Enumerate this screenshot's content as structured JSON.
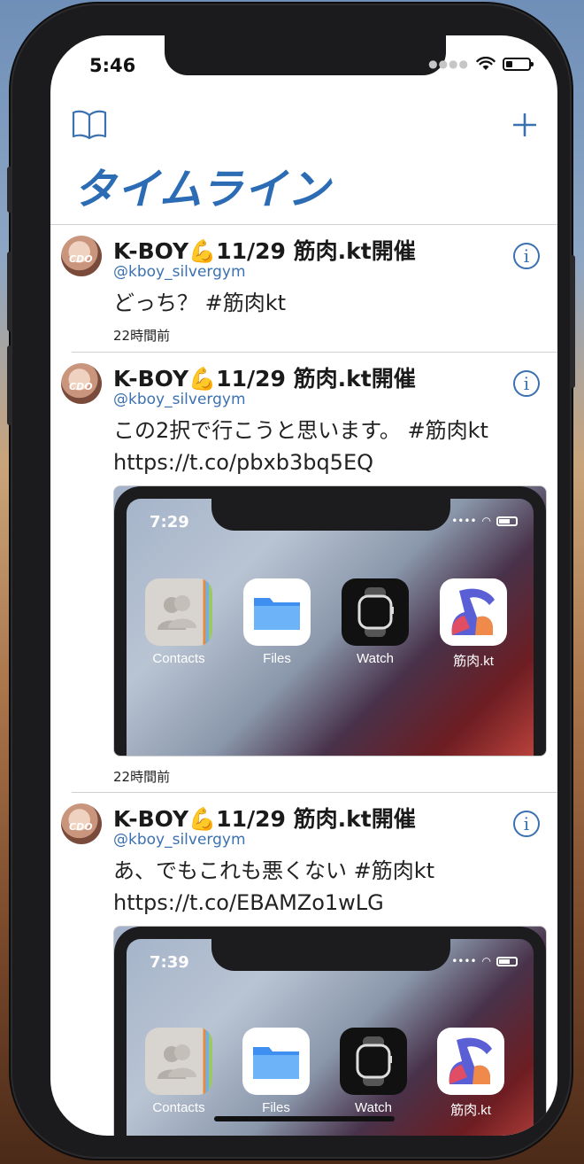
{
  "status_bar": {
    "time": "5:46"
  },
  "header": {
    "title": "タイムライン"
  },
  "posts": [
    {
      "name": "K-BOY💪11/29 筋肉.kt開催",
      "handle": "@kboy_silvergym",
      "text_lines": [
        "どっち？ #筋肉kt"
      ],
      "time": "22時間前"
    },
    {
      "name": "K-BOY💪11/29 筋肉.kt開催",
      "handle": "@kboy_silvergym",
      "text_lines": [
        "この2択で行こうと思います。 #筋肉kt",
        "https://t.co/pbxb3bq5EQ"
      ],
      "time": "22時間前",
      "media": {
        "time": "7:29",
        "apps": [
          {
            "label": "Contacts",
            "icon": "contacts-icon"
          },
          {
            "label": "Files",
            "icon": "files-icon"
          },
          {
            "label": "Watch",
            "icon": "watch-icon"
          },
          {
            "label": "筋肉.kt",
            "icon": "muscle-icon"
          }
        ]
      }
    },
    {
      "name": "K-BOY💪11/29 筋肉.kt開催",
      "handle": "@kboy_silvergym",
      "text_lines": [
        "あ、でもこれも悪くない #筋肉kt",
        "https://t.co/EBAMZo1wLG"
      ],
      "media": {
        "time": "7:39",
        "apps": [
          {
            "label": "Contacts",
            "icon": "contacts-icon"
          },
          {
            "label": "Files",
            "icon": "files-icon"
          },
          {
            "label": "Watch",
            "icon": "watch-icon"
          },
          {
            "label": "筋肉.kt",
            "icon": "muscle-icon"
          }
        ]
      }
    }
  ],
  "colors": {
    "accent": "#3b71b0",
    "title": "#2b6cb4"
  }
}
